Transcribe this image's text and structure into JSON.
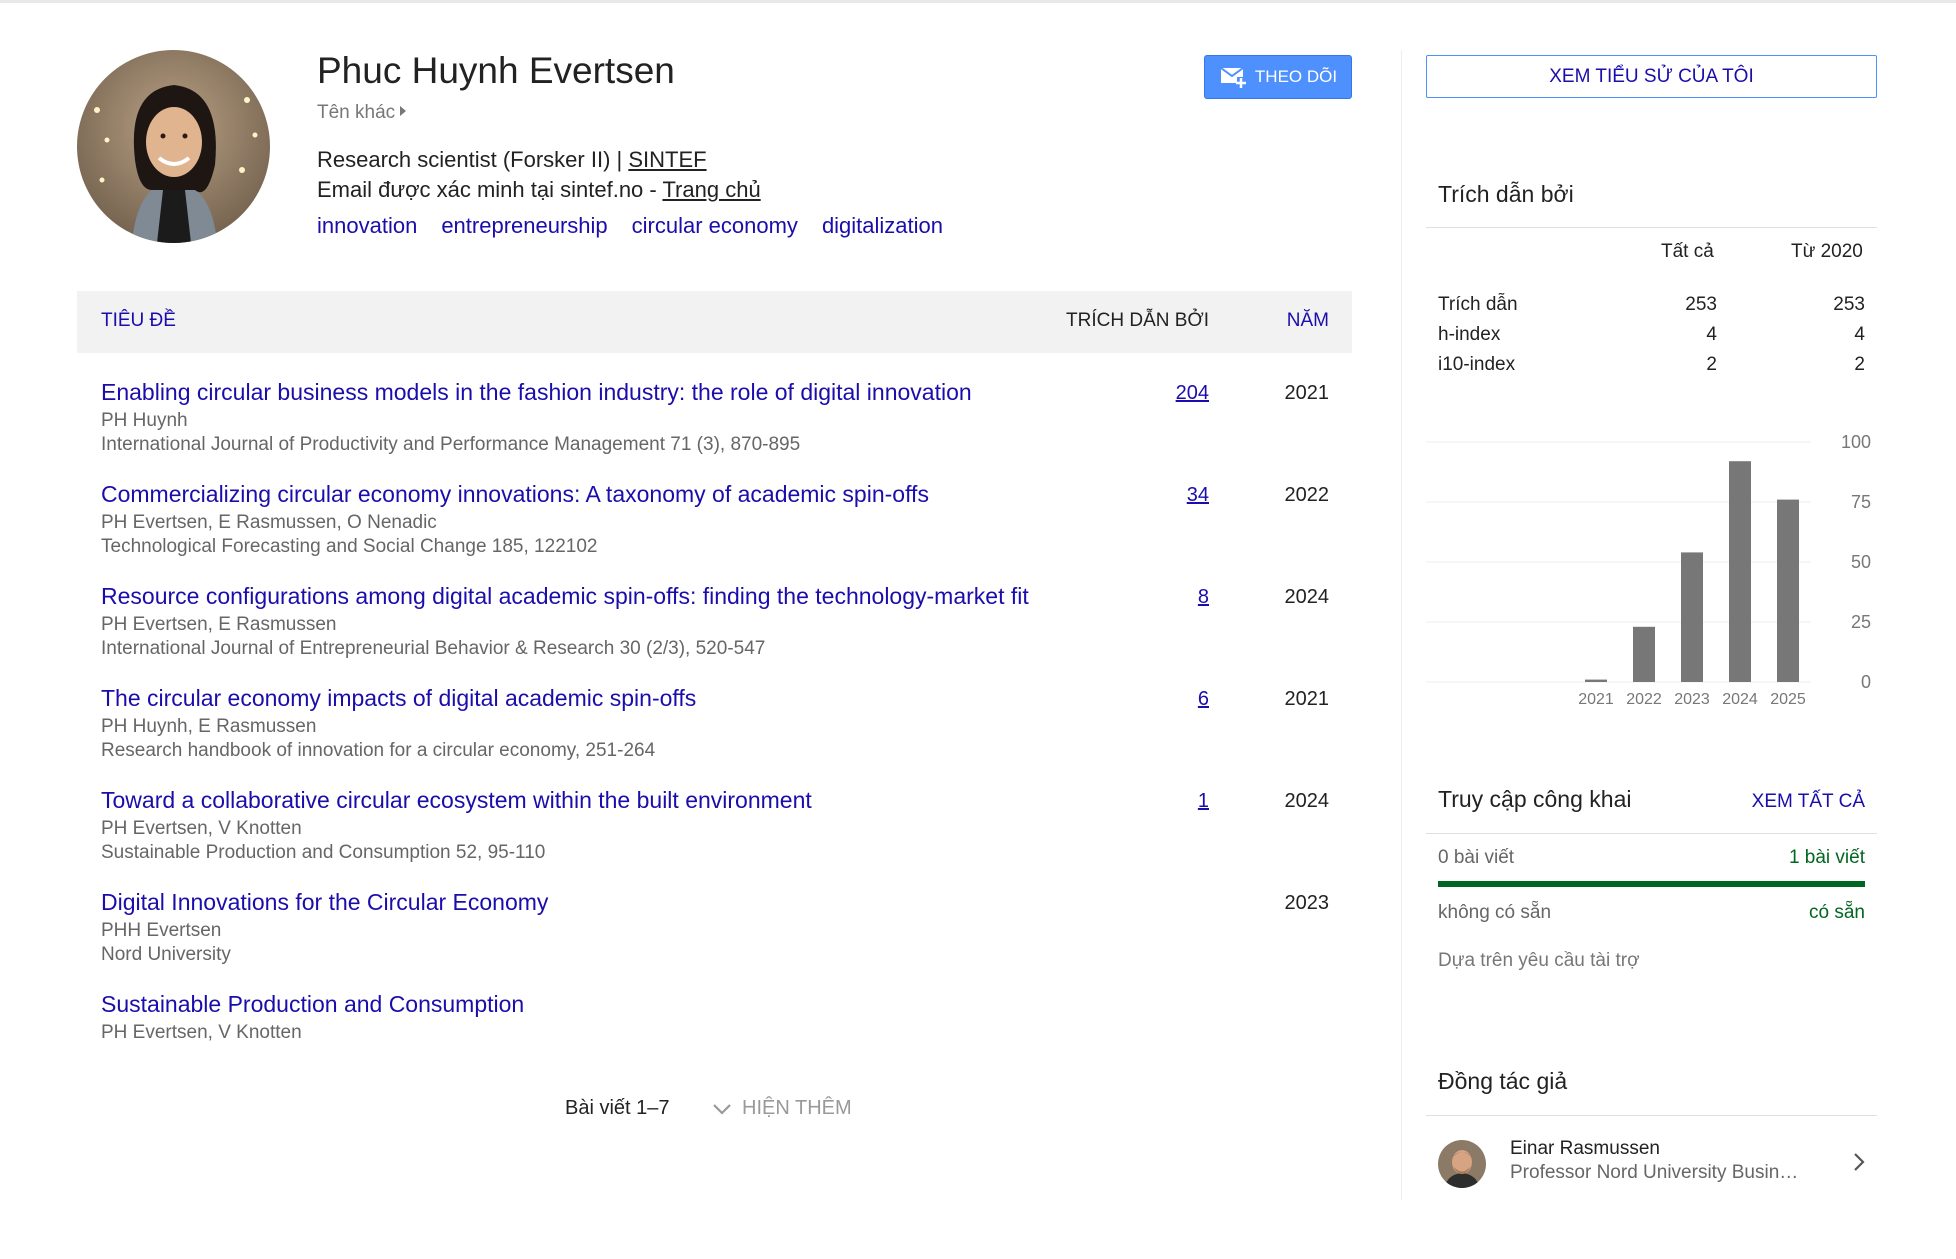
{
  "profile": {
    "name": "Phuc Huynh Evertsen",
    "other_names_label": "Tên khác",
    "affiliation_prefix": "Research scientist (Forsker II) | ",
    "affiliation_link": "SINTEF",
    "email_prefix": "Email được xác minh tại sintef.no - ",
    "homepage_link": "Trang chủ",
    "interests": [
      "innovation",
      "entrepreneurship",
      "circular economy",
      "digitalization"
    ],
    "follow_label": "THEO DÕI",
    "follow_icon": "mail-plus-icon"
  },
  "table": {
    "header": {
      "title": "TIÊU ĐỀ",
      "cited_by": "TRÍCH DẪN BỞI",
      "year": "NĂM"
    },
    "rows": [
      {
        "title": "Enabling circular business models in the fashion industry: the role of digital innovation",
        "authors": "PH Huynh",
        "venue": "International Journal of Productivity and Performance Management 71 (3), 870-895",
        "cites": "204",
        "year": "2021"
      },
      {
        "title": "Commercializing circular economy innovations: A taxonomy of academic spin-offs",
        "authors": "PH Evertsen, E Rasmussen, O Nenadic",
        "venue": "Technological Forecasting and Social Change 185, 122102",
        "cites": "34",
        "year": "2022"
      },
      {
        "title": "Resource configurations among digital academic spin-offs: finding the technology-market fit",
        "authors": "PH Evertsen, E Rasmussen",
        "venue": "International Journal of Entrepreneurial Behavior & Research 30 (2/3), 520-547",
        "cites": "8",
        "year": "2024"
      },
      {
        "title": "The circular economy impacts of digital academic spin-offs",
        "authors": "PH Huynh, E Rasmussen",
        "venue": "Research handbook of innovation for a circular economy, 251-264",
        "cites": "6",
        "year": "2021"
      },
      {
        "title": "Toward a collaborative circular ecosystem within the built environment",
        "authors": "PH Evertsen, V Knotten",
        "venue": "Sustainable Production and Consumption 52, 95-110",
        "cites": "1",
        "year": "2024"
      },
      {
        "title": "Digital Innovations for the Circular Economy",
        "authors": "PHH Evertsen",
        "venue": "Nord University",
        "cites": "",
        "year": "2023"
      },
      {
        "title": "Sustainable Production and Consumption",
        "authors": "PH Evertsen, V Knotten",
        "venue": "",
        "cites": "",
        "year": ""
      }
    ],
    "pager_label": "Bài viết 1–7",
    "show_more_label": "HIỆN THÊM"
  },
  "sidebar": {
    "bio_button": "XEM TIỂU SỬ CỦA TÔI",
    "cited_by": {
      "title": "Trích dẫn bởi",
      "col_all": "Tất cả",
      "col_since": "Từ 2020",
      "rows": [
        {
          "label": "Trích dẫn",
          "all": "253",
          "since": "253"
        },
        {
          "label": "h-index",
          "all": "4",
          "since": "4"
        },
        {
          "label": "i10-index",
          "all": "2",
          "since": "2"
        }
      ]
    },
    "public_access": {
      "title": "Truy cập công khai",
      "view_all": "XEM TẤT CẢ",
      "left_count": "0 bài viết",
      "right_count": "1 bài viết",
      "left_status": "không có sẵn",
      "right_status": "có sẵn",
      "note": "Dựa trên yêu cầu tài trợ",
      "available_fraction": 1.0,
      "bar_color": "#006621"
    },
    "coauthors": {
      "title": "Đồng tác giả",
      "items": [
        {
          "name": "Einar Rasmussen",
          "affiliation": "Professor Nord University Busin…"
        }
      ]
    }
  },
  "chart_data": {
    "type": "bar",
    "categories": [
      "2021",
      "2022",
      "2023",
      "2024",
      "2025"
    ],
    "values": [
      1,
      23,
      54,
      92,
      76
    ],
    "ylim": [
      0,
      100
    ],
    "yticks": [
      "0",
      "25",
      "50",
      "75",
      "100"
    ],
    "grid": true,
    "bar_color": "#777777"
  }
}
